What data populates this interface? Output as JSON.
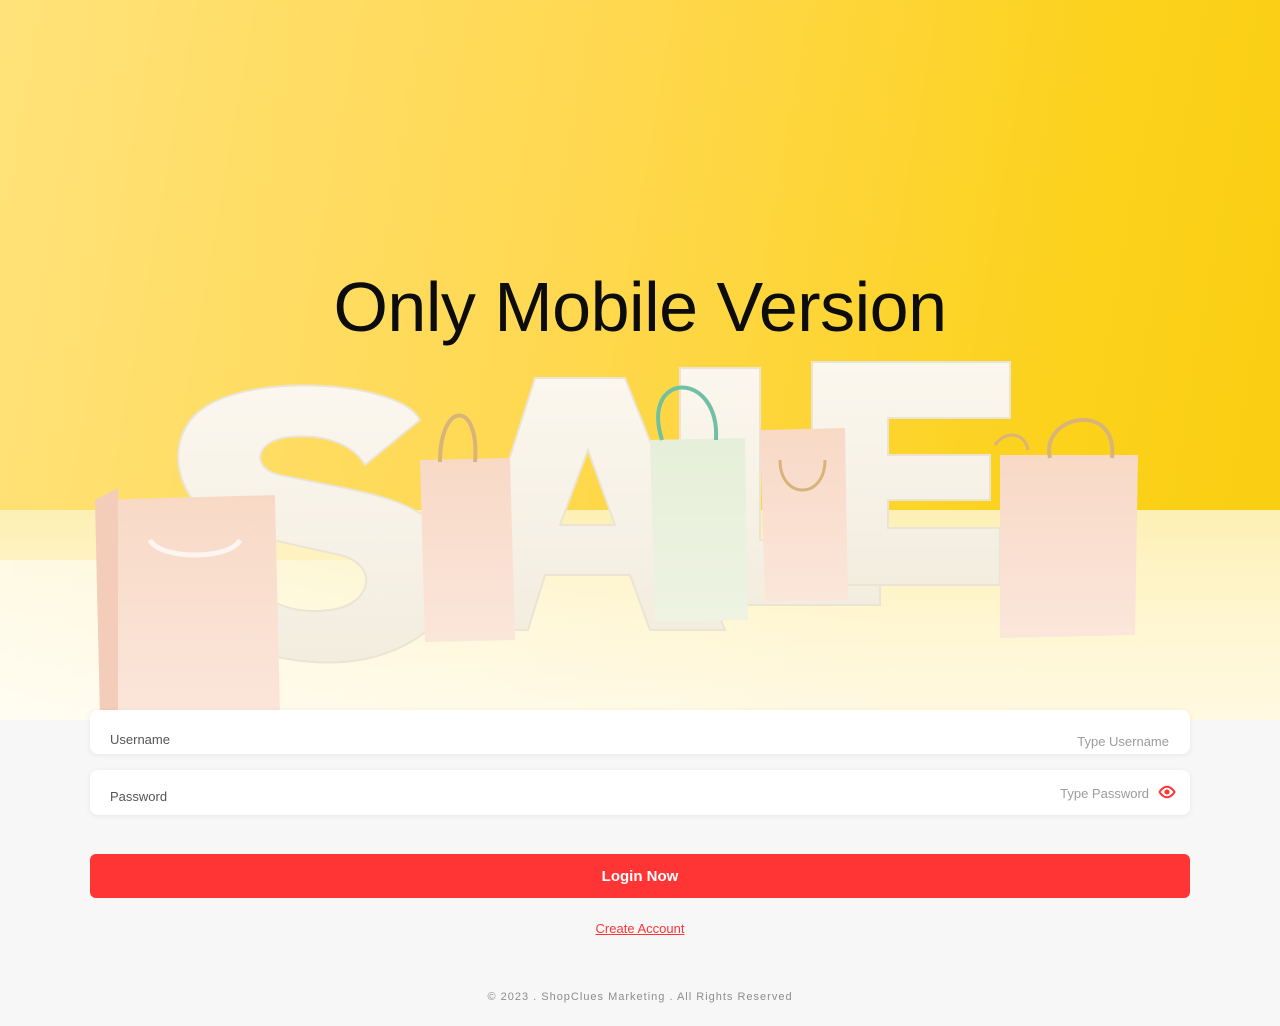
{
  "hero": {
    "title": "Only Mobile Version",
    "banner_image": "sale-letters-with-shopping-bags",
    "banner_word": "SALE"
  },
  "form": {
    "username": {
      "label": "Username",
      "placeholder": "Type Username"
    },
    "password": {
      "label": "Password",
      "placeholder": "Type Password",
      "toggle_icon": "eye-icon"
    },
    "login_label": "Login Now",
    "create_account_label": "Create Account"
  },
  "footer": {
    "copyright": "© 2023 . ShopClues Marketing . All Rights Reserved"
  },
  "colors": {
    "accent": "#ff3434",
    "hero_yellow": "#fcd21c",
    "background": "#f7f7f7"
  }
}
